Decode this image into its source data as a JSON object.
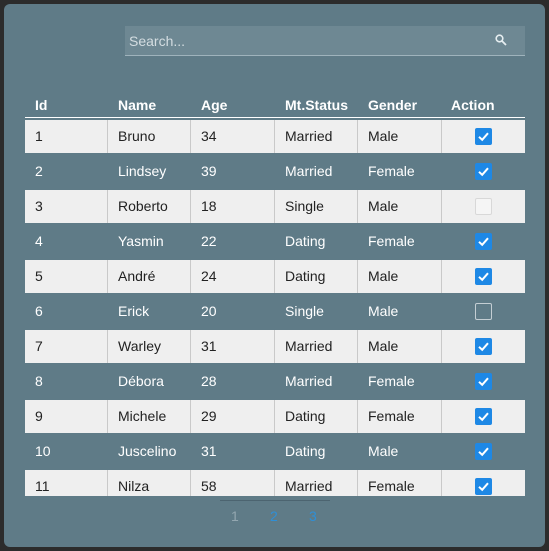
{
  "search": {
    "placeholder": "Search..."
  },
  "columns": [
    "Id",
    "Name",
    "Age",
    "Mt.Status",
    "Gender",
    "Action"
  ],
  "rows": [
    {
      "id": "1",
      "name": "Bruno",
      "age": "34",
      "status": "Married",
      "gender": "Male",
      "checked": true
    },
    {
      "id": "2",
      "name": "Lindsey",
      "age": "39",
      "status": "Married",
      "gender": "Female",
      "checked": true
    },
    {
      "id": "3",
      "name": "Roberto",
      "age": "18",
      "status": "Single",
      "gender": "Male",
      "checked": false
    },
    {
      "id": "4",
      "name": "Yasmin",
      "age": "22",
      "status": "Dating",
      "gender": "Female",
      "checked": true
    },
    {
      "id": "5",
      "name": "André",
      "age": "24",
      "status": "Dating",
      "gender": "Male",
      "checked": true
    },
    {
      "id": "6",
      "name": "Erick",
      "age": "20",
      "status": "Single",
      "gender": "Male",
      "checked": false
    },
    {
      "id": "7",
      "name": "Warley",
      "age": "31",
      "status": "Married",
      "gender": "Male",
      "checked": true
    },
    {
      "id": "8",
      "name": "Débora",
      "age": "28",
      "status": "Married",
      "gender": "Female",
      "checked": true
    },
    {
      "id": "9",
      "name": "Michele",
      "age": "29",
      "status": "Dating",
      "gender": "Female",
      "checked": true
    },
    {
      "id": "10",
      "name": "Juscelino",
      "age": "31",
      "status": "Dating",
      "gender": "Male",
      "checked": true
    },
    {
      "id": "11",
      "name": "Nilza",
      "age": "58",
      "status": "Married",
      "gender": "Female",
      "checked": true
    }
  ],
  "pagination": {
    "pages": [
      "1",
      "2",
      "3"
    ],
    "current": "1"
  },
  "colors": {
    "accent": "#1e88e5",
    "background": "#5f7b87"
  }
}
